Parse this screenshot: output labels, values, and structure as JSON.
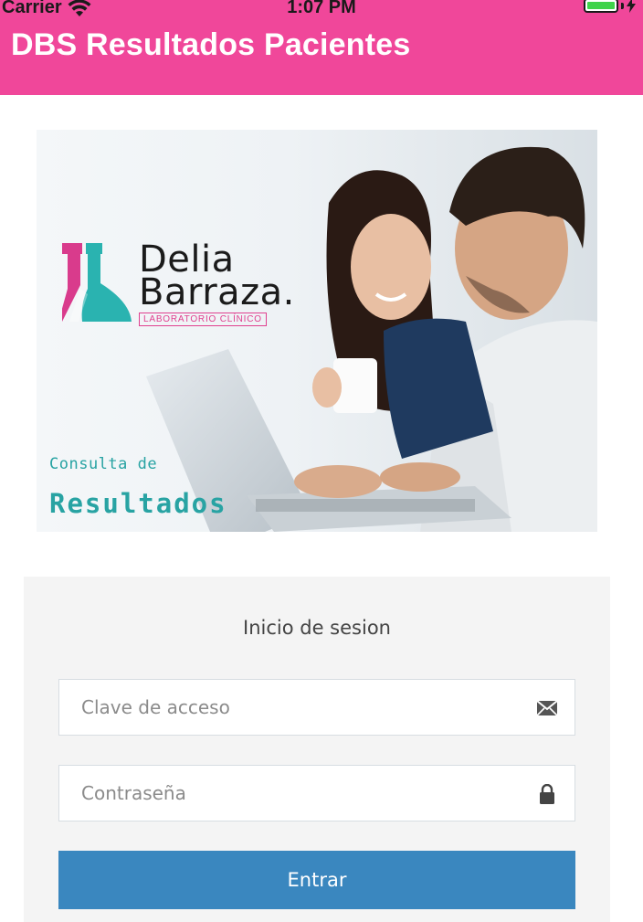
{
  "status_bar": {
    "carrier": "Carrier",
    "time": "1:07 PM",
    "icons": [
      "wifi-icon",
      "battery-icon",
      "charging-bolt-icon"
    ]
  },
  "header": {
    "title": "DBS Resultados Pacientes",
    "background_color": "#f0479a"
  },
  "hero": {
    "brand_line1": "Delia",
    "brand_line2": "Barraza.",
    "tagline": "LABORATORIO CLÍNICO",
    "consulta": "Consulta de",
    "resultados": "Resultados",
    "image_description_icon": "people-laptop-photo"
  },
  "login": {
    "title": "Inicio de sesion",
    "access_key_placeholder": "Clave de acceso",
    "access_key_value": "",
    "password_placeholder": "Contraseña",
    "password_value": "",
    "submit_label": "Entrar",
    "button_color": "#3a87bf",
    "icons": [
      "envelope-icon",
      "lock-icon"
    ]
  }
}
